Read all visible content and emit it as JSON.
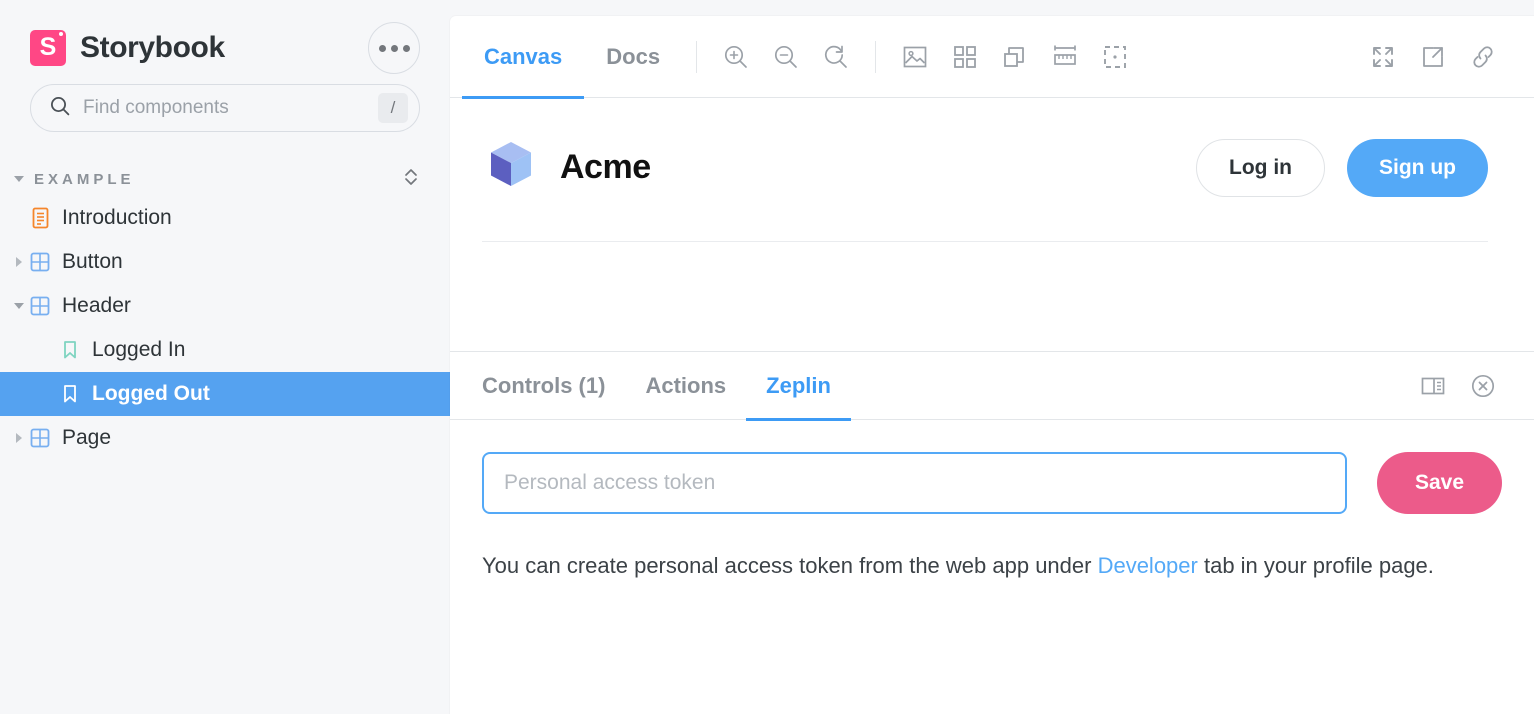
{
  "sidebar": {
    "brand": {
      "name": "Storybook",
      "logo_icon": "storybook-logo",
      "logo_color": "#FF4785"
    },
    "menu_button": {
      "icon": "ellipsis-icon"
    },
    "search": {
      "placeholder": "Find components",
      "value": "",
      "icon": "search-icon",
      "shortcut_key": "/"
    },
    "section": {
      "label": "EXAMPLE",
      "expanded": true,
      "sort_icon": "expand-collapse-icon"
    },
    "items": [
      {
        "label": "Introduction",
        "icon": "document-icon",
        "depth": 0,
        "expandable": false,
        "selected": false,
        "icon_color": "#F5862B"
      },
      {
        "label": "Button",
        "icon": "component-grid-icon",
        "depth": 0,
        "expandable": true,
        "expanded": false,
        "selected": false,
        "icon_color": "#78AFF0"
      },
      {
        "label": "Header",
        "icon": "component-grid-icon",
        "depth": 0,
        "expandable": true,
        "expanded": true,
        "selected": false,
        "icon_color": "#78AFF0"
      },
      {
        "label": "Logged In",
        "icon": "story-bookmark-icon",
        "depth": 1,
        "expandable": false,
        "selected": false,
        "icon_color": "#7FD4C1"
      },
      {
        "label": "Logged Out",
        "icon": "story-bookmark-icon",
        "depth": 1,
        "expandable": false,
        "selected": true,
        "icon_color": "#FFFFFF"
      },
      {
        "label": "Page",
        "icon": "component-grid-icon",
        "depth": 0,
        "expandable": true,
        "expanded": false,
        "selected": false,
        "icon_color": "#78AFF0"
      }
    ],
    "selected_color": "#55A2F0"
  },
  "toolbar": {
    "tabs": [
      {
        "label": "Canvas",
        "active": true
      },
      {
        "label": "Docs",
        "active": false
      }
    ],
    "active_color": "#3D9BF5",
    "tools": [
      {
        "name": "zoom-in-icon"
      },
      {
        "name": "zoom-out-icon"
      },
      {
        "name": "zoom-reset-icon"
      },
      {
        "name": "background-image-icon"
      },
      {
        "name": "grid-icon"
      },
      {
        "name": "viewport-icon"
      },
      {
        "name": "measure-ruler-icon"
      },
      {
        "name": "outline-icon"
      }
    ],
    "right_tools": [
      {
        "name": "fullscreen-icon"
      },
      {
        "name": "open-new-tab-icon"
      },
      {
        "name": "copy-link-icon"
      }
    ]
  },
  "canvas": {
    "story": {
      "brand_name": "Acme",
      "logo_icon": "acme-cube-logo",
      "login_label": "Log in",
      "signup_label": "Sign up",
      "signup_color": "#54A9F7"
    }
  },
  "panel": {
    "tabs": [
      {
        "label": "Controls (1)",
        "active": false
      },
      {
        "label": "Actions",
        "active": false
      },
      {
        "label": "Zeplin",
        "active": true
      }
    ],
    "layout_icon": "panel-position-icon",
    "close_icon": "close-circle-icon",
    "zeplin": {
      "token_placeholder": "Personal access token",
      "token_value": "",
      "save_label": "Save",
      "save_color": "#EC5B8A",
      "help_text_before": "You can create personal access token from the web app under ",
      "help_link": "Developer",
      "help_text_after": " tab in your profile page."
    }
  }
}
